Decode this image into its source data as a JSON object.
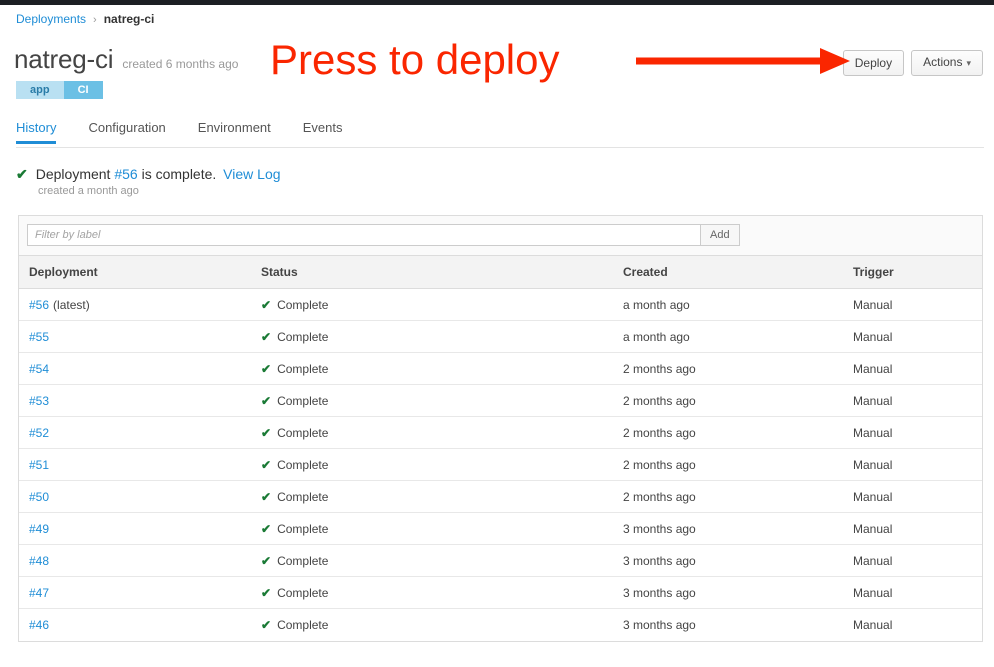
{
  "breadcrumb": {
    "parent": "Deployments",
    "separator": "›",
    "current": "natreg-ci"
  },
  "header": {
    "title": "natreg-ci",
    "created": "created 6 months ago",
    "tags": [
      {
        "label": "app",
        "style": "light"
      },
      {
        "label": "CI",
        "style": "medium"
      }
    ],
    "buttons": {
      "deploy": "Deploy",
      "actions": "Actions",
      "actions_caret": "⌄"
    }
  },
  "tabs": [
    {
      "label": "History",
      "active": true
    },
    {
      "label": "Configuration",
      "active": false
    },
    {
      "label": "Environment",
      "active": false
    },
    {
      "label": "Events",
      "active": false
    }
  ],
  "status_banner": {
    "check_icon": "✔",
    "prefix": "Deployment",
    "deployment_number": "#56",
    "suffix": "is complete.",
    "view_log": "View Log",
    "sub": "created a month ago"
  },
  "filter": {
    "placeholder": "Filter by label",
    "value": "",
    "add_label": "Add"
  },
  "table": {
    "columns": [
      "Deployment",
      "Status",
      "Created",
      "Trigger"
    ],
    "rows": [
      {
        "deployment": "#56",
        "latest": "(latest)",
        "status": "Complete",
        "created": "a month ago",
        "trigger": "Manual"
      },
      {
        "deployment": "#55",
        "latest": "",
        "status": "Complete",
        "created": "a month ago",
        "trigger": "Manual"
      },
      {
        "deployment": "#54",
        "latest": "",
        "status": "Complete",
        "created": "2 months ago",
        "trigger": "Manual"
      },
      {
        "deployment": "#53",
        "latest": "",
        "status": "Complete",
        "created": "2 months ago",
        "trigger": "Manual"
      },
      {
        "deployment": "#52",
        "latest": "",
        "status": "Complete",
        "created": "2 months ago",
        "trigger": "Manual"
      },
      {
        "deployment": "#51",
        "latest": "",
        "status": "Complete",
        "created": "2 months ago",
        "trigger": "Manual"
      },
      {
        "deployment": "#50",
        "latest": "",
        "status": "Complete",
        "created": "2 months ago",
        "trigger": "Manual"
      },
      {
        "deployment": "#49",
        "latest": "",
        "status": "Complete",
        "created": "3 months ago",
        "trigger": "Manual"
      },
      {
        "deployment": "#48",
        "latest": "",
        "status": "Complete",
        "created": "3 months ago",
        "trigger": "Manual"
      },
      {
        "deployment": "#47",
        "latest": "",
        "status": "Complete",
        "created": "3 months ago",
        "trigger": "Manual"
      },
      {
        "deployment": "#46",
        "latest": "",
        "status": "Complete",
        "created": "3 months ago",
        "trigger": "Manual"
      }
    ],
    "status_check_icon": "✔"
  },
  "annotation": {
    "text": "Press to deploy",
    "color": "#fa2600",
    "arrow": "arrow-right"
  },
  "colors": {
    "link": "#1f8dd6",
    "accent": "#1f8dd6",
    "success": "#1a7a35",
    "annotation": "#fa2600",
    "tag_app_bg": "#b9e0f2",
    "tag_ci_bg": "#6cc0e5",
    "topbar": "#1c1f23"
  }
}
